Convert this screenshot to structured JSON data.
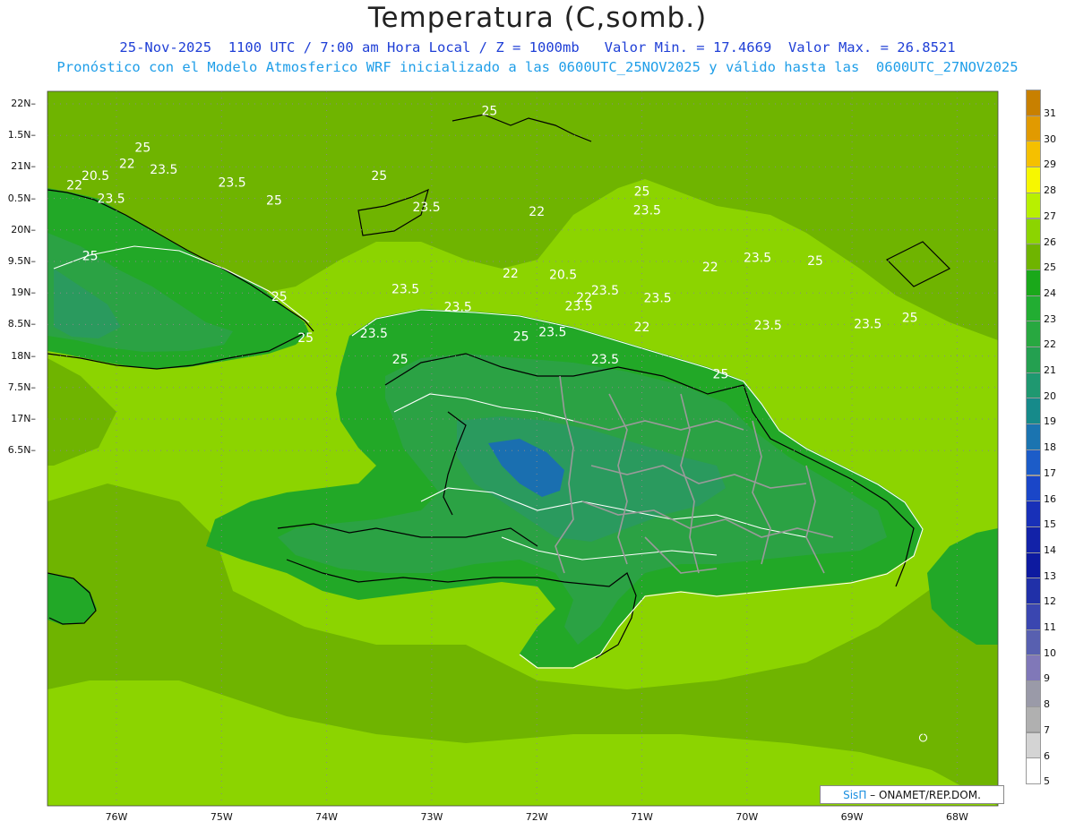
{
  "header": {
    "title": "Temperatura (C,somb.)",
    "line1": "25-Nov-2025  1100 UTC / 7:00 am Hora Local / Z = 1000mb   Valor Min. = 17.4669  Valor Max. = 26.8521",
    "line2": "Pronóstico con el Modelo Atmosferico WRF inicializado a las 0600UTC_25NOV2025 y válido hasta las  0600UTC_27NOV2025"
  },
  "axes": {
    "lat_labels": [
      "22N",
      "1.5N",
      "21N",
      "0.5N",
      "20N",
      "9.5N",
      "19N",
      "8.5N",
      "18N",
      "7.5N",
      "17N",
      "6.5N"
    ],
    "lon_labels": [
      "76W",
      "75W",
      "74W",
      "73W",
      "72W",
      "71W",
      "70W",
      "69W",
      "68W"
    ]
  },
  "colorbar": {
    "labels": [
      "31",
      "30",
      "29",
      "28",
      "27",
      "26",
      "25",
      "24",
      "23",
      "22",
      "21",
      "20",
      "19",
      "18",
      "17",
      "16",
      "15",
      "14",
      "13",
      "12",
      "11",
      "10",
      "9",
      "8",
      "7",
      "6",
      "5"
    ],
    "colors": [
      "#c88000",
      "#e19a00",
      "#f5c000",
      "#f7f700",
      "#b8f000",
      "#8cd400",
      "#6fb400",
      "#1aa81a",
      "#22ad32",
      "#28a840",
      "#24a050",
      "#1f9870",
      "#168a8a",
      "#1b74b0",
      "#1c5cc8",
      "#1a46c8",
      "#1830b8",
      "#1222a8",
      "#0d1aa0",
      "#2030a8",
      "#3a46b0",
      "#5860b0",
      "#8078b8",
      "#9a9aa8",
      "#b0b0b0",
      "#d4d4d4",
      "#ffffff"
    ]
  },
  "map": {
    "colors": {
      "sea": "#8cd400",
      "sea_warm": "#6fb400",
      "land_24": "#22a827",
      "land_23": "#2ba244",
      "land_22": "#2a9a5e",
      "land_21": "#1f8f7c",
      "land_20": "#1a6fb0"
    },
    "contour_labels": [
      {
        "text": "25",
        "lon": -72.45,
        "lat": 21.88
      },
      {
        "text": "25",
        "lon": -75.75,
        "lat": 21.3
      },
      {
        "text": "22",
        "lon": -75.9,
        "lat": 21.04
      },
      {
        "text": "23.5",
        "lon": -75.55,
        "lat": 20.95
      },
      {
        "text": "20.5",
        "lon": -76.2,
        "lat": 20.85
      },
      {
        "text": "22",
        "lon": -76.4,
        "lat": 20.7
      },
      {
        "text": "23.5",
        "lon": -74.9,
        "lat": 20.74
      },
      {
        "text": "23.5",
        "lon": -76.05,
        "lat": 20.49
      },
      {
        "text": "25",
        "lon": -74.5,
        "lat": 20.46
      },
      {
        "text": "25",
        "lon": -73.5,
        "lat": 20.85
      },
      {
        "text": "25",
        "lon": -71.0,
        "lat": 20.6
      },
      {
        "text": "23.5",
        "lon": -73.05,
        "lat": 20.35
      },
      {
        "text": "22",
        "lon": -72.0,
        "lat": 20.28
      },
      {
        "text": "23.5",
        "lon": -70.95,
        "lat": 20.3
      },
      {
        "text": "25",
        "lon": -76.25,
        "lat": 19.58
      },
      {
        "text": "25",
        "lon": -69.35,
        "lat": 19.5
      },
      {
        "text": "23.5",
        "lon": -69.9,
        "lat": 19.55
      },
      {
        "text": "22",
        "lon": -70.35,
        "lat": 19.4
      },
      {
        "text": "22",
        "lon": -72.25,
        "lat": 19.3
      },
      {
        "text": "20.5",
        "lon": -71.75,
        "lat": 19.28
      },
      {
        "text": "23.5",
        "lon": -73.25,
        "lat": 19.05
      },
      {
        "text": "23.5",
        "lon": -71.35,
        "lat": 19.03
      },
      {
        "text": "22",
        "lon": -71.55,
        "lat": 18.92
      },
      {
        "text": "23.5",
        "lon": -70.85,
        "lat": 18.91
      },
      {
        "text": "25",
        "lon": -74.45,
        "lat": 18.93
      },
      {
        "text": "23.5",
        "lon": -72.75,
        "lat": 18.77
      },
      {
        "text": "23.5",
        "lon": -71.6,
        "lat": 18.78
      },
      {
        "text": "25",
        "lon": -68.45,
        "lat": 18.6
      },
      {
        "text": "23.5",
        "lon": -69.8,
        "lat": 18.48
      },
      {
        "text": "23.5",
        "lon": -68.85,
        "lat": 18.5
      },
      {
        "text": "22",
        "lon": -71.0,
        "lat": 18.45
      },
      {
        "text": "23.5",
        "lon": -73.55,
        "lat": 18.35
      },
      {
        "text": "25",
        "lon": -74.2,
        "lat": 18.28
      },
      {
        "text": "25",
        "lon": -72.15,
        "lat": 18.3
      },
      {
        "text": "23.5",
        "lon": -71.85,
        "lat": 18.37
      },
      {
        "text": "23.5",
        "lon": -71.35,
        "lat": 17.94
      },
      {
        "text": "25",
        "lon": -73.3,
        "lat": 17.94
      },
      {
        "text": "25",
        "lon": -70.25,
        "lat": 17.7
      }
    ]
  },
  "credit": {
    "brand": "SisΠ",
    "text": "– ONAMET/REP.DOM."
  }
}
